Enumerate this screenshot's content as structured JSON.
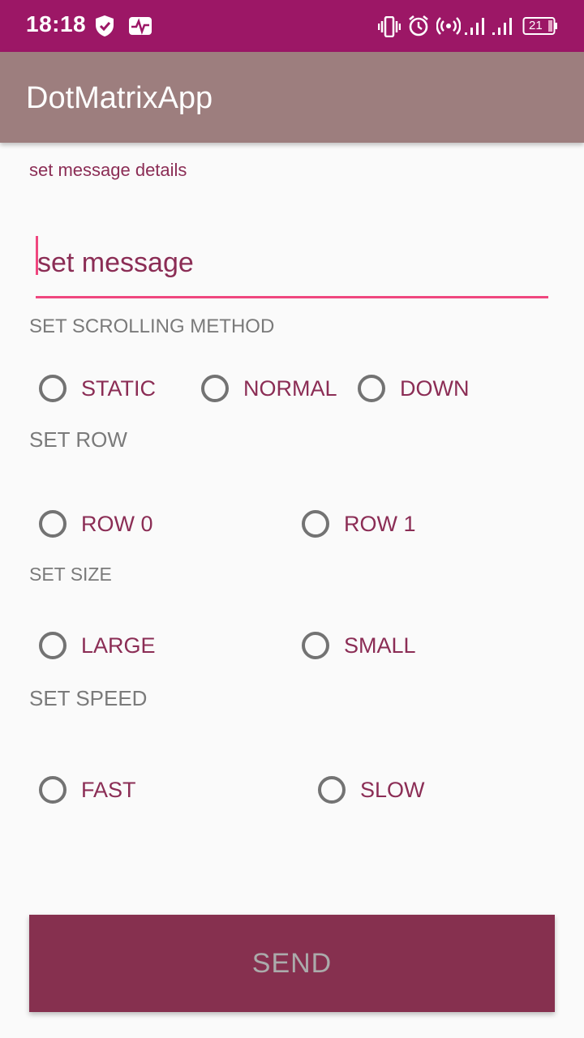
{
  "status_bar": {
    "time": "18:18",
    "battery": "21",
    "icons": [
      "shield-check-icon",
      "activity-icon",
      "vibrate-icon",
      "alarm-icon",
      "hotspot-icon",
      "signal-icon",
      "signal-icon",
      "battery-icon"
    ]
  },
  "app_bar": {
    "title": "DotMatrixApp"
  },
  "form": {
    "details_label": "set message details",
    "message_placeholder": "set message",
    "message_value": "",
    "scrolling": {
      "title": "SET SCROLLING METHOD",
      "options": [
        "STATIC",
        "NORMAL",
        "DOWN"
      ]
    },
    "row": {
      "title": "SET ROW",
      "options": [
        "ROW 0",
        "ROW 1"
      ]
    },
    "size": {
      "title": "SET SIZE",
      "options": [
        "LARGE",
        "SMALL"
      ]
    },
    "speed": {
      "title": "SET SPEED",
      "options": [
        "FAST",
        "SLOW"
      ]
    },
    "send_label": "SEND"
  },
  "colors": {
    "status_bar": "#9c1766",
    "app_bar": "#9d7e7e",
    "accent": "#f0477f",
    "label_text": "#8b2d55",
    "button": "#86304f"
  }
}
